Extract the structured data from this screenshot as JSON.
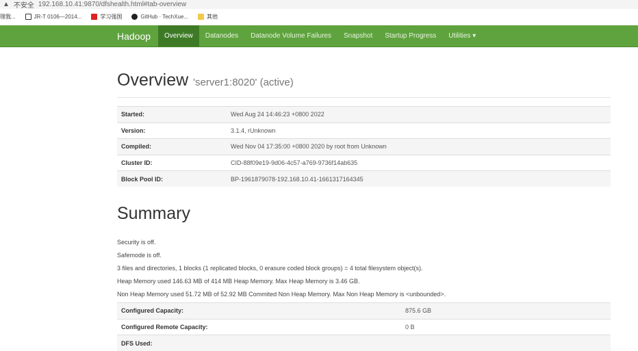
{
  "browser": {
    "security": "不安全",
    "url": "192.168.10.41:9870/dfshealth.html#tab-overview",
    "bookmarks": [
      "理我...",
      "JR-T 0106—2014...",
      "学习强国",
      "GitHub · TechXue...",
      "其他"
    ]
  },
  "nav": {
    "brand": "Hadoop",
    "items": [
      "Overview",
      "Datanodes",
      "Datanode Volume Failures",
      "Snapshot",
      "Startup Progress",
      "Utilities ▾"
    ]
  },
  "overview": {
    "title": "Overview",
    "subtitle": "'server1:8020' (active)",
    "rows": [
      [
        "Started:",
        "Wed Aug 24 14:46:23 +0800 2022"
      ],
      [
        "Version:",
        "3.1.4, rUnknown"
      ],
      [
        "Compiled:",
        "Wed Nov 04 17:35:00 +0800 2020 by root from Unknown"
      ],
      [
        "Cluster ID:",
        "CID-88f09e19-9d06-4c57-a769-9736f14ab635"
      ],
      [
        "Block Pool ID:",
        "BP-1961879078-192.168.10.41-1661317164345"
      ]
    ]
  },
  "summary": {
    "title": "Summary",
    "lines": [
      "Security is off.",
      "Safemode is off.",
      "3 files and directories, 1 blocks (1 replicated blocks, 0 erasure coded block groups) = 4 total filesystem object(s).",
      "Heap Memory used 146.63 MB of 414 MB Heap Memory. Max Heap Memory is 3.46 GB.",
      "Non Heap Memory used 51.72 MB of 52.92 MB Commited Non Heap Memory. Max Non Heap Memory is <unbounded>."
    ],
    "rows": [
      [
        "Configured Capacity:",
        "875.6 GB"
      ],
      [
        "Configured Remote Capacity:",
        "0 B"
      ],
      [
        "DFS Used:",
        ""
      ]
    ]
  }
}
